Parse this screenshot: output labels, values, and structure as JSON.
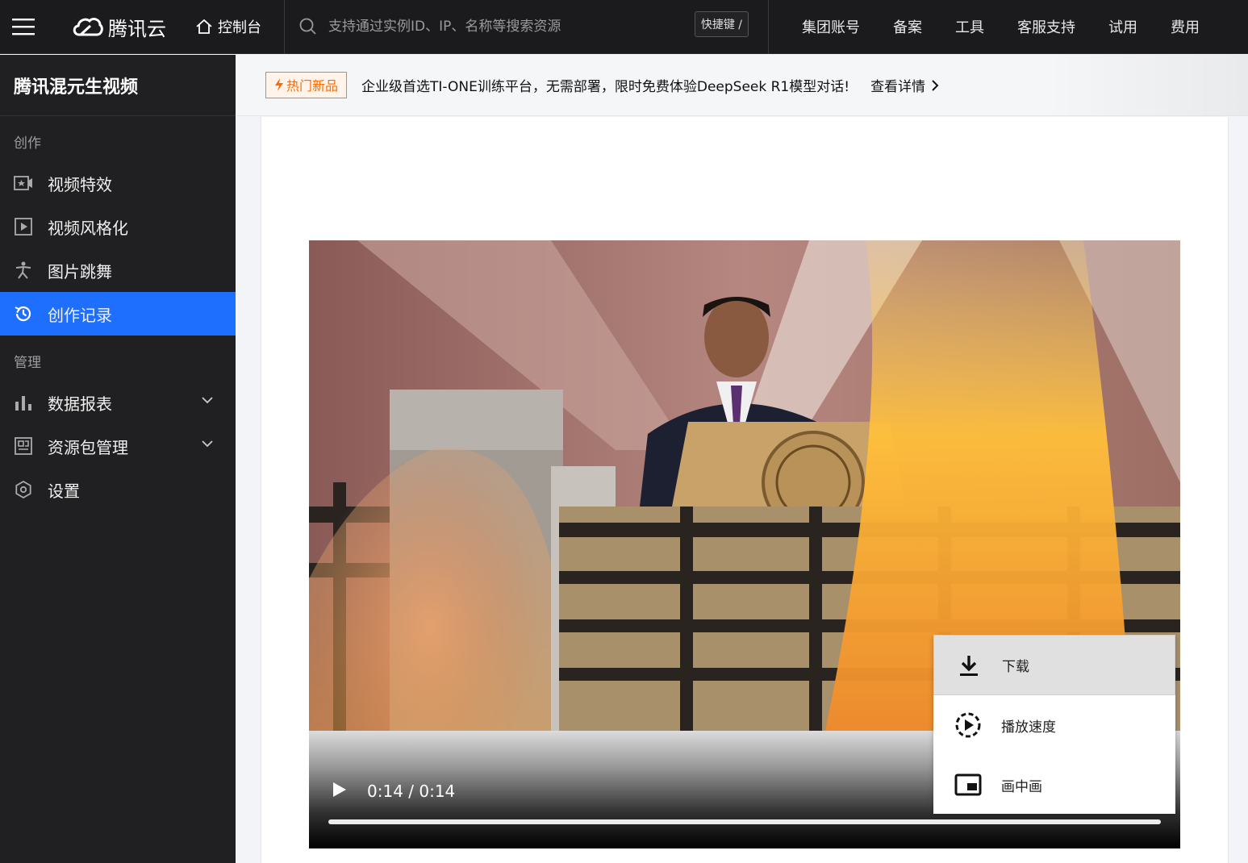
{
  "topbar": {
    "logo_text": "腾讯云",
    "console_label": "控制台",
    "search_placeholder": "支持通过实例ID、IP、名称等搜索资源",
    "shortcut_label": "快捷键 /",
    "nav": [
      "集团账号",
      "备案",
      "工具",
      "客服支持",
      "试用",
      "费用"
    ]
  },
  "sidebar": {
    "title": "腾讯混元生视频",
    "groups": [
      {
        "label": "创作",
        "items": [
          {
            "label": "视频特效",
            "icon": "video-effect-icon"
          },
          {
            "label": "视频风格化",
            "icon": "video-play-icon"
          },
          {
            "label": "图片跳舞",
            "icon": "dance-icon"
          },
          {
            "label": "创作记录",
            "icon": "history-icon",
            "active": true
          }
        ]
      },
      {
        "label": "管理",
        "items": [
          {
            "label": "数据报表",
            "icon": "bar-chart-icon",
            "expandable": true
          },
          {
            "label": "资源包管理",
            "icon": "package-icon",
            "expandable": true
          },
          {
            "label": "设置",
            "icon": "settings-icon"
          }
        ]
      }
    ]
  },
  "banner": {
    "badge": "热门新品",
    "text": "企业级首选TI-ONE训练平台，无需部署，限时免费体验DeepSeek R1模型对话!",
    "link": "查看详情"
  },
  "video": {
    "time": "0:14 / 0:14",
    "progress": 1.0
  },
  "context_menu": {
    "items": [
      {
        "label": "下载",
        "icon": "download-icon"
      },
      {
        "label": "播放速度",
        "icon": "playback-speed-icon"
      },
      {
        "label": "画中画",
        "icon": "picture-in-picture-icon"
      }
    ]
  },
  "colors": {
    "active_nav": "#1f6fff",
    "badge_orange": "#ff6a00",
    "topbar_bg": "#1b1b1d",
    "sidebar_bg": "#202022"
  }
}
